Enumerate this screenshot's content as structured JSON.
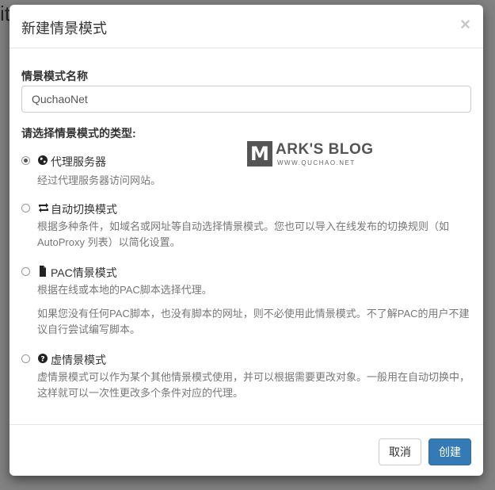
{
  "modal": {
    "title": "新建情景模式",
    "close_symbol": "×"
  },
  "form": {
    "name_label": "情景模式名称",
    "name_value": "QuchaoNet",
    "type_label": "请选择情景模式的类型:"
  },
  "options": [
    {
      "title": "代理服务器",
      "icon": "globe-icon",
      "checked": true,
      "desc": [
        "经过代理服务器访问网站。"
      ]
    },
    {
      "title": "自动切换模式",
      "icon": "retweet-icon",
      "checked": false,
      "desc": [
        "根据多种条件，如域名或网址等自动选择情景模式。您也可以导入在线发布的切换规则（如 AutoProxy 列表）以简化设置。"
      ]
    },
    {
      "title": "PAC情景模式",
      "icon": "file-icon",
      "checked": false,
      "desc": [
        "根据在线或本地的PAC脚本选择代理。",
        "如果您没有任何PAC脚本，也没有脚本的网址，则不必使用此情景模式。不了解PAC的用户不建议自行尝试编写脚本。"
      ]
    },
    {
      "title": "虚情景模式",
      "icon": "question-sign-icon",
      "checked": false,
      "desc": [
        "虚情景模式可以作为某个其他情景模式使用，并可以根据需要更改对象。一般用在自动切换中，这样就可以一次性更改多个条件对应的代理。"
      ]
    }
  ],
  "watermark": {
    "letter": "M",
    "text": "ARK'S BLOG",
    "sub": "WWW.QUCHAO.NET"
  },
  "footer": {
    "cancel_label": "取消",
    "create_label": "创建"
  },
  "colors": {
    "primary": "#337ab7",
    "text": "#333333",
    "muted": "#777777"
  }
}
